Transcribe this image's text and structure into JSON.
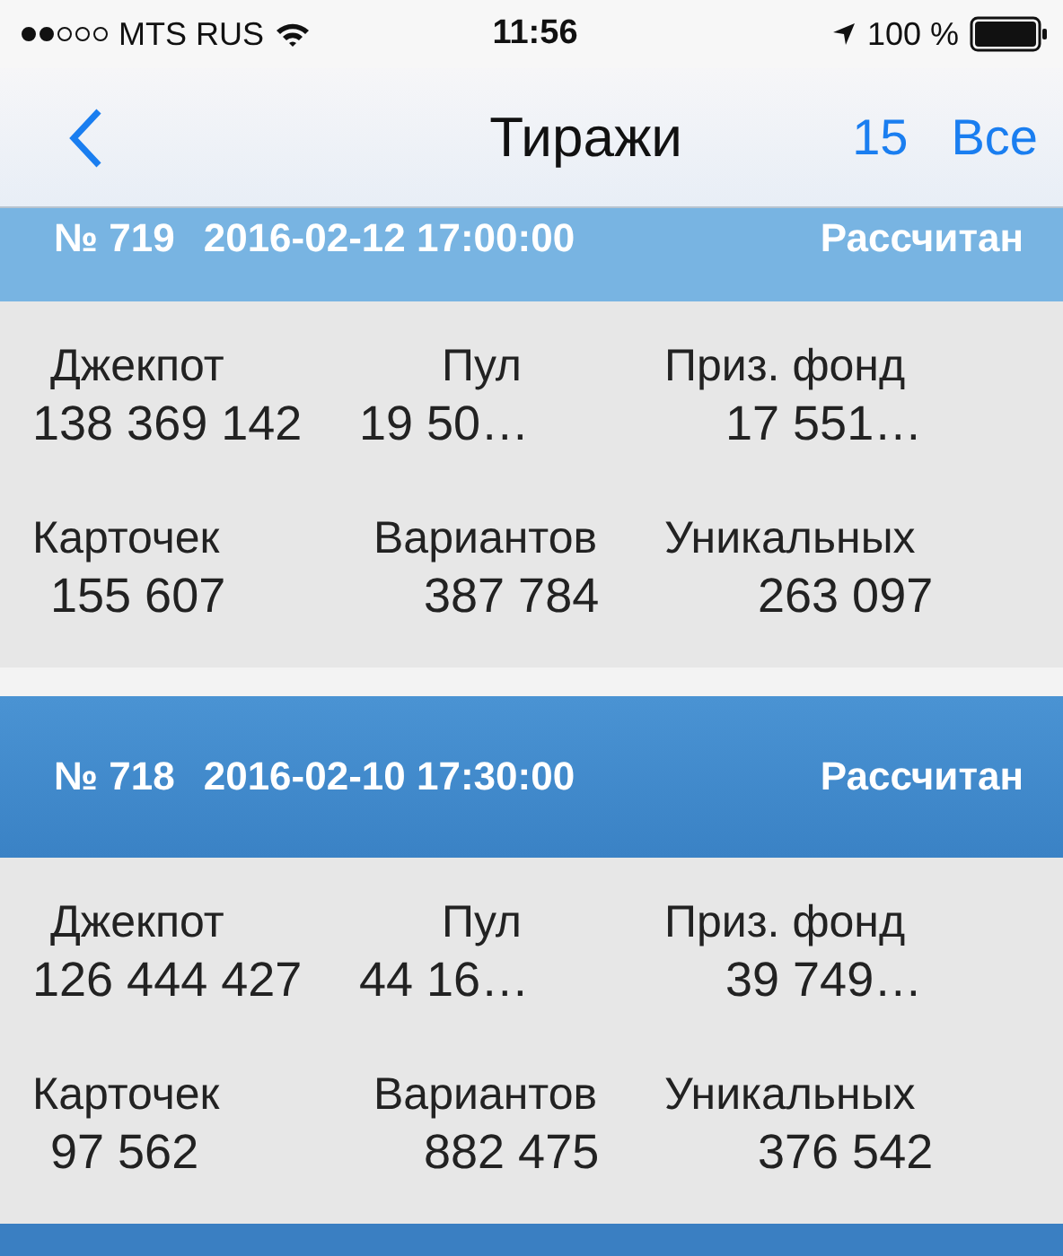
{
  "status_bar": {
    "signal_dots": [
      {
        "filled": true
      },
      {
        "filled": true
      },
      {
        "filled": false
      },
      {
        "filled": false
      },
      {
        "filled": false
      }
    ],
    "carrier": "MTS RUS",
    "time": "11:56",
    "battery": "100 %"
  },
  "nav": {
    "title": "Тиражи",
    "count": "15",
    "action": "Все"
  },
  "draws": [
    {
      "number": "№ 719",
      "date": "2016-02-12 17:00:00",
      "status": "Рассчитан",
      "pinned": true,
      "stats": [
        {
          "label": "Джекпот",
          "value": "138 369 142"
        },
        {
          "label": "Пул",
          "value": "19 50…"
        },
        {
          "label": "Приз. фонд",
          "value": "17 551…"
        },
        {
          "label": "Карточек",
          "value": "155 607"
        },
        {
          "label": "Вариантов",
          "value": "387 784"
        },
        {
          "label": "Уникальных",
          "value": "263 097"
        }
      ]
    },
    {
      "number": "№ 718",
      "date": "2016-02-10 17:30:00",
      "status": "Рассчитан",
      "pinned": false,
      "stats": [
        {
          "label": "Джекпот",
          "value": "126 444 427"
        },
        {
          "label": "Пул",
          "value": "44 16…"
        },
        {
          "label": "Приз. фонд",
          "value": "39 749…"
        },
        {
          "label": "Карточек",
          "value": "97 562"
        },
        {
          "label": "Вариантов",
          "value": "882 475"
        },
        {
          "label": "Уникальных",
          "value": "376 542"
        }
      ]
    }
  ]
}
